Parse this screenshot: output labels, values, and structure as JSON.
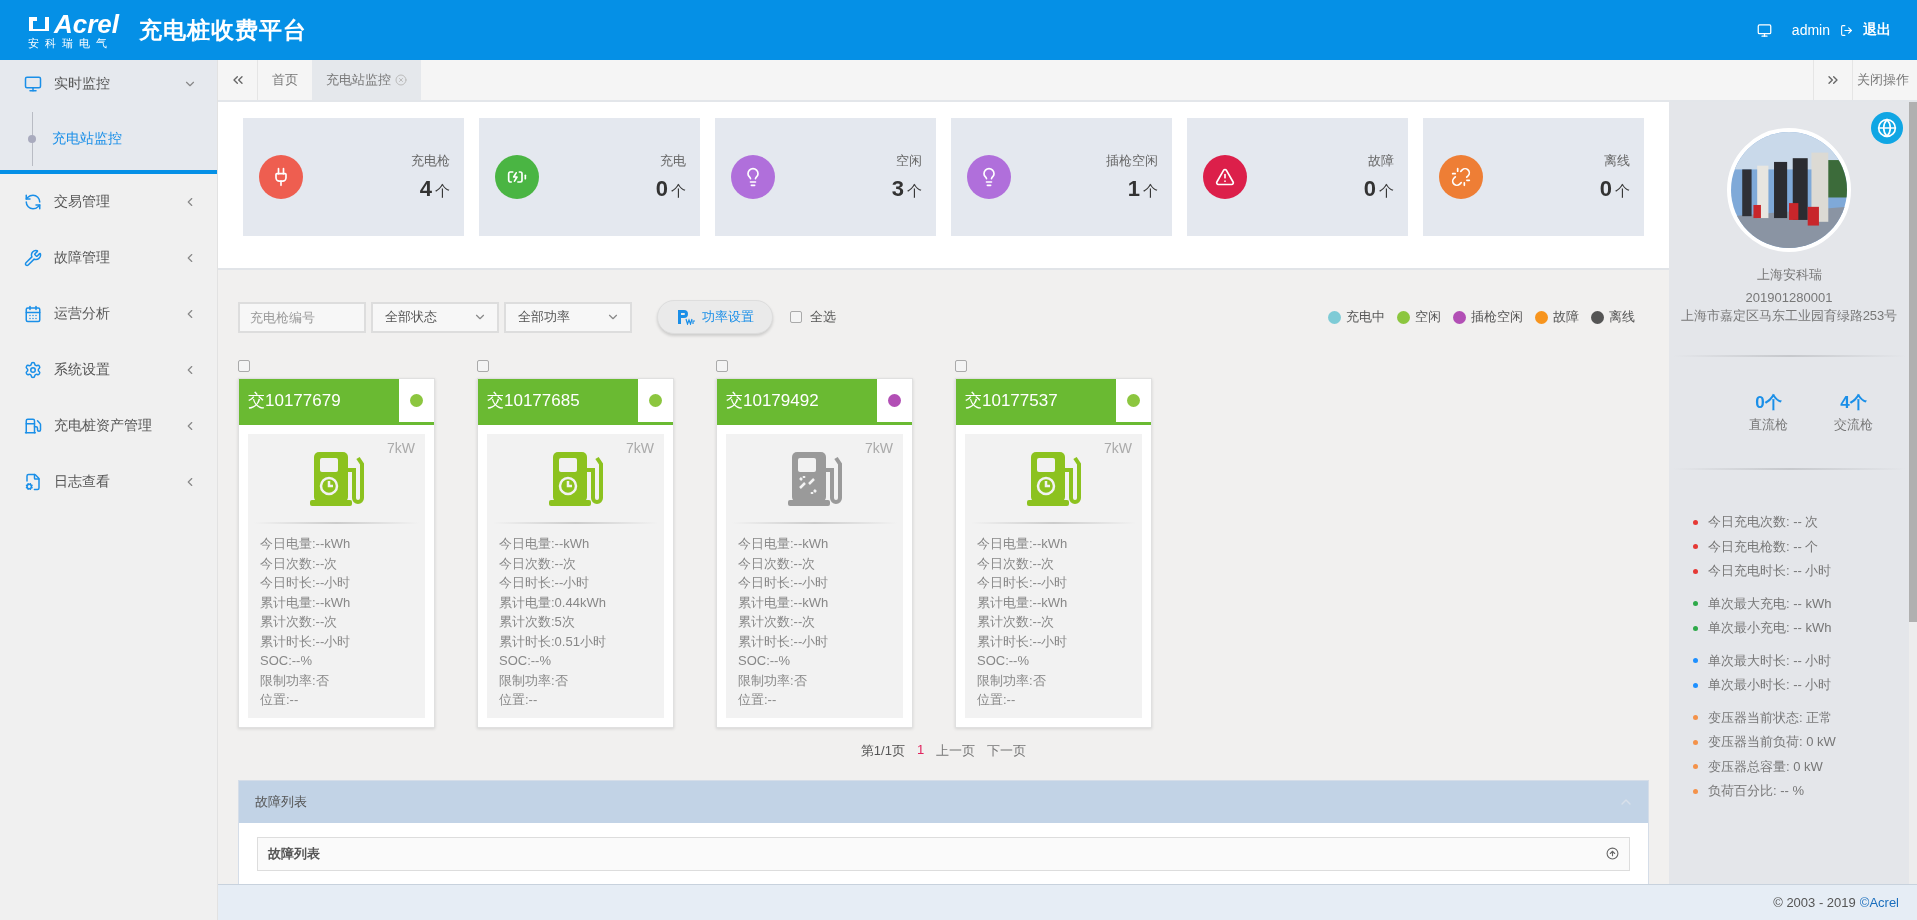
{
  "header": {
    "logo": {
      "brand": "Acrel",
      "sub": "安科瑞电气"
    },
    "title": "充电桩收费平台",
    "user": "admin",
    "logout": "退出"
  },
  "sidebar": {
    "items": [
      {
        "label": "实时监控",
        "expanded": true,
        "children": [
          {
            "label": "充电站监控",
            "selected": true
          }
        ]
      },
      {
        "label": "交易管理",
        "expanded": false
      },
      {
        "label": "故障管理",
        "expanded": false
      },
      {
        "label": "运营分析",
        "expanded": false
      },
      {
        "label": "系统设置",
        "expanded": false
      },
      {
        "label": "充电桩资产管理",
        "expanded": false
      },
      {
        "label": "日志查看",
        "expanded": false
      }
    ]
  },
  "tabs": [
    {
      "label": "首页",
      "selected": false,
      "closable": false
    },
    {
      "label": "充电站监控",
      "selected": true,
      "closable": true
    }
  ],
  "tab_bar_action": "关闭操作",
  "stats": [
    {
      "label": "充电枪",
      "value": "4",
      "unit": "个",
      "color": "#ee5e50"
    },
    {
      "label": "充电",
      "value": "0",
      "unit": "个",
      "color": "#4ab543"
    },
    {
      "label": "空闲",
      "value": "3",
      "unit": "个",
      "color": "#b06fdb"
    },
    {
      "label": "插枪空闲",
      "value": "1",
      "unit": "个",
      "color": "#b06fdb"
    },
    {
      "label": "故障",
      "value": "0",
      "unit": "个",
      "color": "#dc1f4a"
    },
    {
      "label": "离线",
      "value": "0",
      "unit": "个",
      "color": "#ee7e35"
    }
  ],
  "filters": {
    "gun_number": {
      "placeholder": "充电枪编号"
    },
    "status": "全部状态",
    "power": "全部功率",
    "power_button": "功率设置",
    "select_all": {
      "label": "全选",
      "checked": false
    }
  },
  "legend": [
    {
      "label": "充电中",
      "color": "#7ecbd6"
    },
    {
      "label": "空闲",
      "color": "#8cc63f"
    },
    {
      "label": "插枪空闲",
      "color": "#b24fb5"
    },
    {
      "label": "故障",
      "color": "#f7941d"
    },
    {
      "label": "离线",
      "color": "#555555"
    }
  ],
  "chargers": [
    {
      "name": "交10177679",
      "color": "#8cc63f",
      "checked": false,
      "kind": "normal",
      "power": "7kW",
      "lines": [
        "今日电量:--kWh",
        "今日次数:--次",
        "今日时长:--小时",
        "累计电量:--kWh",
        "累计次数:--次",
        "累计时长:--小时",
        "SOC:--%",
        "限制功率:否",
        "位置:--"
      ]
    },
    {
      "name": "交10177685",
      "color": "#8cc63f",
      "checked": false,
      "kind": "normal",
      "power": "7kW",
      "lines": [
        "今日电量:--kWh",
        "今日次数:--次",
        "今日时长:--小时",
        "累计电量:0.44kWh",
        "累计次数:5次",
        "累计时长:0.51小时",
        "SOC:--%",
        "限制功率:否",
        "位置:--"
      ]
    },
    {
      "name": "交10179492",
      "color": "#b24fb5",
      "checked": false,
      "kind": "unlinked",
      "power": "7kW",
      "lines": [
        "今日电量:--kWh",
        "今日次数:--次",
        "今日时长:--小时",
        "累计电量:--kWh",
        "累计次数:--次",
        "累计时长:--小时",
        "SOC:--%",
        "限制功率:否",
        "位置:--"
      ]
    },
    {
      "name": "交10177537",
      "color": "#8cc63f",
      "checked": false,
      "kind": "normal",
      "power": "7kW",
      "lines": [
        "今日电量:--kWh",
        "今日次数:--次",
        "今日时长:--小时",
        "累计电量:--kWh",
        "累计次数:--次",
        "累计时长:--小时",
        "SOC:--%",
        "限制功率:否",
        "位置:--"
      ]
    }
  ],
  "pagination": {
    "info": "第1/1页",
    "pages": [
      {
        "label": "1",
        "selected": true
      }
    ],
    "prev": "上一页",
    "next": "下一页"
  },
  "fault_panel": {
    "title": "故障列表",
    "expanded": true,
    "inner_title": "故障列表"
  },
  "site": {
    "name": "上海安科瑞",
    "code": "201901280001",
    "address": "上海市嘉定区马东工业园育绿路253号",
    "counts": [
      {
        "value": "0个",
        "label": "直流枪"
      },
      {
        "value": "4个",
        "label": "交流枪"
      }
    ],
    "groups": [
      {
        "color": "#e53935",
        "items": [
          "今日充电次数: -- 次",
          "今日充电枪数: -- 个",
          "今日充电时长: -- 小时"
        ]
      },
      {
        "color": "#2eaa4a",
        "items": [
          "单次最大充电: -- kWh",
          "单次最小充电: -- kWh"
        ]
      },
      {
        "color": "#1e90ff",
        "items": [
          "单次最大时长: -- 小时",
          "单次最小时长: -- 小时"
        ]
      },
      {
        "color": "#f4924a",
        "items": [
          "变压器当前状态: 正常",
          "变压器当前负荷: 0 kW",
          "变压器总容量: 0 kW",
          "负荷百分比: -- %"
        ]
      }
    ]
  },
  "footer": {
    "copyright": "© 2003 - 2019",
    "link": "©Acrel"
  }
}
